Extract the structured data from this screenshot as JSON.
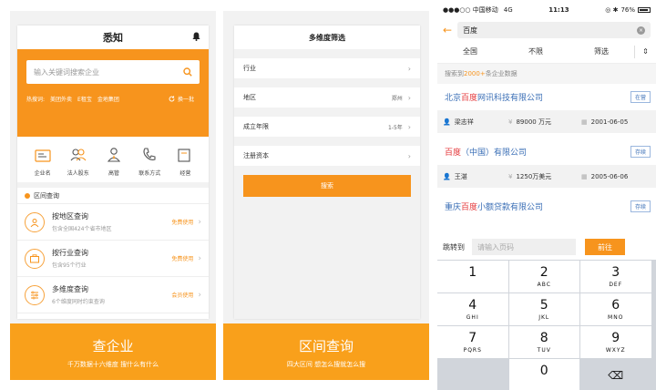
{
  "panel1": {
    "app_title": "悉知",
    "search_placeholder": "输入关键词搜索企业",
    "hot_label": "热搜词:",
    "hot_terms": [
      "美团外卖",
      "E租宝",
      "金地集团"
    ],
    "refresh_label": "换一批",
    "categories": [
      "企业名",
      "法人股东",
      "高管",
      "联系方式",
      "经营"
    ],
    "section_title": "区间查询",
    "rows": [
      {
        "title": "按地区查询",
        "sub": "包含全国424个省市地区",
        "action": "免费使用"
      },
      {
        "title": "按行业查询",
        "sub": "包含95个行业",
        "action": "免费使用"
      },
      {
        "title": "多维度查询",
        "sub": "6个维度同时约束查询",
        "action": "会员使用"
      }
    ],
    "banner_title": "查企业",
    "banner_sub": "千万数据十六维度  搜什么有什么"
  },
  "panel2": {
    "title": "多维度筛选",
    "filters": [
      {
        "label": "行业",
        "value": ""
      },
      {
        "label": "地区",
        "value": "郑州"
      },
      {
        "label": "成立年限",
        "value": "1-5年"
      },
      {
        "label": "注册资本",
        "value": ""
      }
    ],
    "search_button": "搜索",
    "banner_title": "区间查询",
    "banner_sub": "四大区间  想怎么搜就怎么搜"
  },
  "panel3": {
    "status": {
      "carrier": "●●●○○ 中国移动",
      "network": "4G",
      "time": "11:13",
      "battery": "76%"
    },
    "search_value": "百度",
    "filter_tabs": [
      "全国",
      "不限",
      "筛选"
    ],
    "sort_icon": "⇕",
    "found_prefix": "搜索到",
    "found_count": "2000+",
    "found_suffix": "条企业数据",
    "companies": [
      {
        "pre": "北京",
        "hl": "百度",
        "post": "网讯科技有限公司",
        "status": "在营",
        "person": "梁志祥",
        "capital": "89000 万元",
        "date": "2001-06-05"
      },
      {
        "pre": "",
        "hl": "百度",
        "post": "（中国）有限公司",
        "status": "存续",
        "person": "王湛",
        "capital": "1250万美元",
        "date": "2005-06-06"
      },
      {
        "pre": "重庆",
        "hl": "百度",
        "post": "小额贷款有限公司",
        "status": "存续",
        "person": "",
        "capital": "",
        "date": ""
      }
    ],
    "jump_label": "跳转到",
    "jump_placeholder": "请输入页码",
    "jump_button": "前往",
    "keys": [
      {
        "n": "1",
        "l": ""
      },
      {
        "n": "2",
        "l": "ABC"
      },
      {
        "n": "3",
        "l": "DEF"
      },
      {
        "n": "4",
        "l": "GHI"
      },
      {
        "n": "5",
        "l": "JKL"
      },
      {
        "n": "6",
        "l": "MNO"
      },
      {
        "n": "7",
        "l": "PQRS"
      },
      {
        "n": "8",
        "l": "TUV"
      },
      {
        "n": "9",
        "l": "WXYZ"
      },
      {
        "n": "",
        "l": ""
      },
      {
        "n": "0",
        "l": ""
      },
      {
        "n": "⌫",
        "l": ""
      }
    ]
  }
}
